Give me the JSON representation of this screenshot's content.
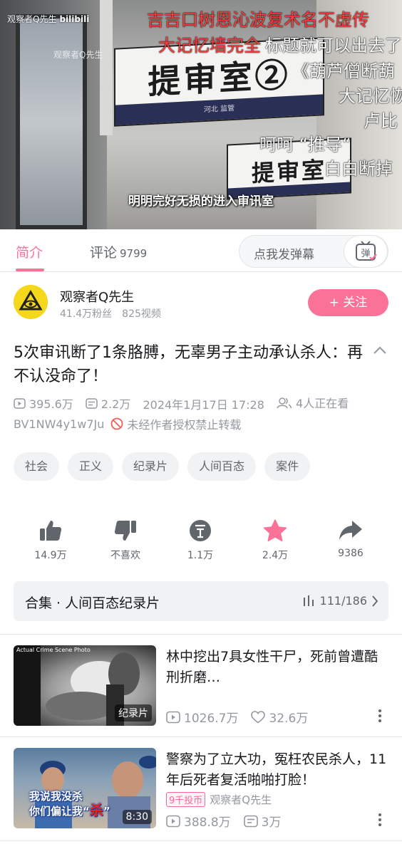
{
  "video": {
    "watermark_user": "观察者Q先生",
    "watermark_logo": "bilibili",
    "watermark_overlay": "观察者Q先生",
    "sign_main": "提审室②",
    "sign_main_bar": "河北    监管",
    "sign_second": "提审室",
    "danmaku": [
      {
        "text": "吉吉口树恩沁波复术名不虚传",
        "color": "red"
      },
      {
        "text": "大记忆墙完全",
        "color": "red"
      },
      {
        "text": "标题就可以出去了",
        "color": "white"
      },
      {
        "text": "《葫芦僧断葫",
        "color": "white"
      },
      {
        "text": "大记忆恢",
        "color": "white"
      },
      {
        "text": "卢比",
        "color": "white"
      },
      {
        "text": "呵呵      “推导“",
        "color": "white"
      },
      {
        "text": "白白断掉",
        "color": "white"
      }
    ],
    "subtitle": "明明完好无损的进入审讯室"
  },
  "tabs": {
    "intro": "简介",
    "comments": "评论",
    "comments_count": "9799",
    "danmu_placeholder": "点我发弹幕",
    "danmu_button": "弹"
  },
  "uploader": {
    "name": "观察者Q先生",
    "fans": "41.4万粉丝",
    "videos": "825视频",
    "follow": "+ 关注"
  },
  "video_info": {
    "title": "5次审讯断了1条胳膊，无辜男子主动承认杀人：再不认没命了！",
    "plays": "395.6万",
    "danmaku_count": "2.2万",
    "date": "2024年1月17日 17:28",
    "watching": "4人正在看",
    "bvid": "BV1NW4y1w7Ju",
    "no_repost": "未经作者授权禁止转载"
  },
  "tags": [
    "社会",
    "正义",
    "纪录片",
    "人间百态",
    "案件"
  ],
  "actions": {
    "like": "14.9万",
    "dislike": "不喜欢",
    "coin": "1.1万",
    "favorite": "2.4万",
    "share": "9386"
  },
  "collection": {
    "title": "合集 · 人间百态纪录片",
    "progress": "111/186"
  },
  "recommendations": [
    {
      "title": "林中挖出7具女性干尸，死前曾遭酷刑折磨…",
      "badge": "纪录片",
      "thumb_text": "Actual Crime Scene Photo",
      "plays": "1026.7万",
      "likes": "32.6万"
    },
    {
      "title": "警察为了立大功，冤枉农民杀人，11年后死者复活啪啪打脸！",
      "badge": "8:30",
      "thumb_caption_1": "我说我没杀",
      "thumb_caption_2": "你们偏让我“杀”",
      "coin_badge": "9千投币",
      "author": "观察者Q先生",
      "plays": "388.8万",
      "danmaku": "3万"
    }
  ],
  "colors": {
    "accent": "#fb7299",
    "text_primary": "#18191c",
    "text_secondary": "#9499a0"
  }
}
